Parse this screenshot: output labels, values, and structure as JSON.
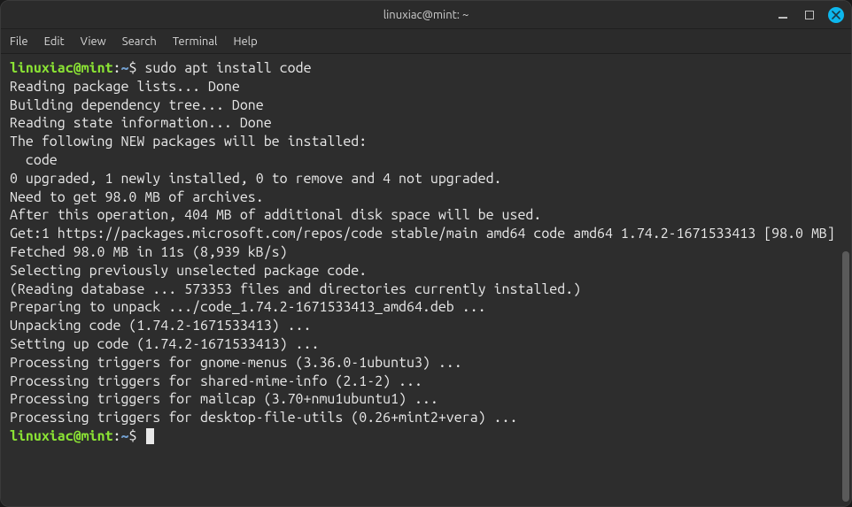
{
  "window": {
    "title": "linuxiac@mint: ~"
  },
  "menubar": {
    "items": [
      "File",
      "Edit",
      "View",
      "Search",
      "Terminal",
      "Help"
    ]
  },
  "prompt": {
    "user": "linuxiac",
    "at": "@",
    "host": "mint",
    "colon": ":",
    "path": "~",
    "symbol": "$"
  },
  "command": "sudo apt install code",
  "output_lines": [
    "Reading package lists... Done",
    "Building dependency tree... Done",
    "Reading state information... Done",
    "The following NEW packages will be installed:",
    "  code",
    "0 upgraded, 1 newly installed, 0 to remove and 4 not upgraded.",
    "Need to get 98.0 MB of archives.",
    "After this operation, 404 MB of additional disk space will be used.",
    "Get:1 https://packages.microsoft.com/repos/code stable/main amd64 code amd64 1.74.2-1671533413 [98.0 MB]",
    "Fetched 98.0 MB in 11s (8,939 kB/s)",
    "Selecting previously unselected package code.",
    "(Reading database ... 573353 files and directories currently installed.)",
    "Preparing to unpack .../code_1.74.2-1671533413_amd64.deb ...",
    "Unpacking code (1.74.2-1671533413) ...",
    "Setting up code (1.74.2-1671533413) ...",
    "Processing triggers for gnome-menus (3.36.0-1ubuntu3) ...",
    "Processing triggers for shared-mime-info (2.1-2) ...",
    "Processing triggers for mailcap (3.70+nmu1ubuntu1) ...",
    "Processing triggers for desktop-file-utils (0.26+mint2+vera) ..."
  ],
  "scroll": {
    "thumb_top_pct": 44,
    "thumb_height_pct": 56
  }
}
